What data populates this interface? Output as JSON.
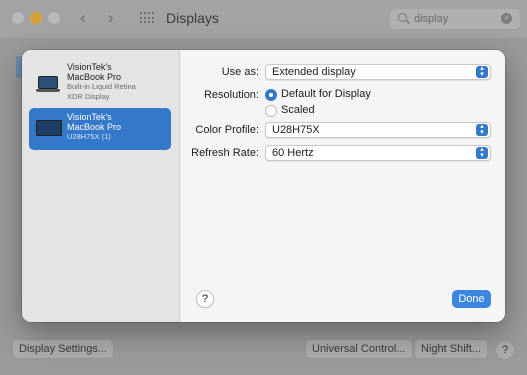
{
  "window": {
    "title": "Displays",
    "search": {
      "value": "display",
      "placeholder": "Search"
    }
  },
  "background_buttons": {
    "display_settings": "Display Settings...",
    "universal_control": "Universal Control...",
    "night_shift": "Night Shift...",
    "help": "?"
  },
  "sidebar": {
    "displays": [
      {
        "name_line1": "VisionTek's",
        "name_line2": "MacBook Pro",
        "sub_line1": "Built-in Liquid Retina",
        "sub_line2": "XDR Display",
        "selected": false,
        "icon": "laptop-icon"
      },
      {
        "name_line1": "VisionTek's",
        "name_line2": "MacBook Pro",
        "sub_line1": "U28H75X (1)",
        "sub_line2": "",
        "selected": true,
        "icon": "monitor-icon"
      }
    ]
  },
  "settings": {
    "use_as": {
      "label": "Use as:",
      "value": "Extended display"
    },
    "resolution": {
      "label": "Resolution:",
      "options": [
        {
          "label": "Default for Display",
          "selected": true
        },
        {
          "label": "Scaled",
          "selected": false
        }
      ]
    },
    "color_profile": {
      "label": "Color Profile:",
      "value": "U28H75X"
    },
    "refresh_rate": {
      "label": "Refresh Rate:",
      "value": "60 Hertz"
    }
  },
  "sheet_buttons": {
    "help": "?",
    "done": "Done"
  },
  "colors": {
    "accent": "#3478c9",
    "done": "#3a86e0"
  }
}
